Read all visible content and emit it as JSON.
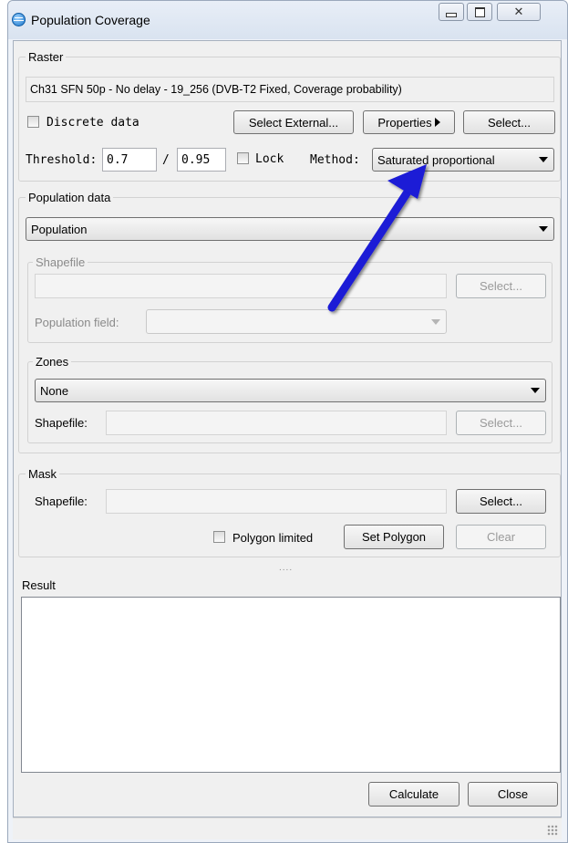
{
  "window": {
    "title": "Population Coverage",
    "minimize": "—",
    "maximize": "▢",
    "close": "✕"
  },
  "raster": {
    "label": "Raster",
    "value": "Ch31 SFN 50p - No delay - 19_256 (DVB-T2 Fixed, Coverage probability)",
    "discrete_label": "Discrete data",
    "select_external": "Select External...",
    "properties": "Properties",
    "select": "Select...",
    "threshold_label": "Threshold:",
    "threshold_1": "0.7",
    "slash": "/",
    "threshold_2": "0.95",
    "lock_label": "Lock",
    "method_label": "Method:",
    "method_value": "Saturated proportional"
  },
  "population": {
    "label": "Population data",
    "source_value": "Population",
    "shapefile_label": "Shapefile",
    "shapefile_value": "",
    "select": "Select...",
    "field_label": "Population field:",
    "field_value": ""
  },
  "zones": {
    "label": "Zones",
    "value": "None",
    "shapefile_label": "Shapefile:",
    "shapefile_value": "",
    "select": "Select..."
  },
  "mask": {
    "label": "Mask",
    "shapefile_label": "Shapefile:",
    "shapefile_value": "",
    "select": "Select...",
    "polygon_limited_label": "Polygon limited",
    "set_polygon": "Set Polygon",
    "clear": "Clear"
  },
  "splitter": "....",
  "result": {
    "label": "Result",
    "text": ""
  },
  "footer": {
    "calculate": "Calculate",
    "close": "Close"
  },
  "annotation": {
    "arrow_color": "#1a1ad6"
  }
}
